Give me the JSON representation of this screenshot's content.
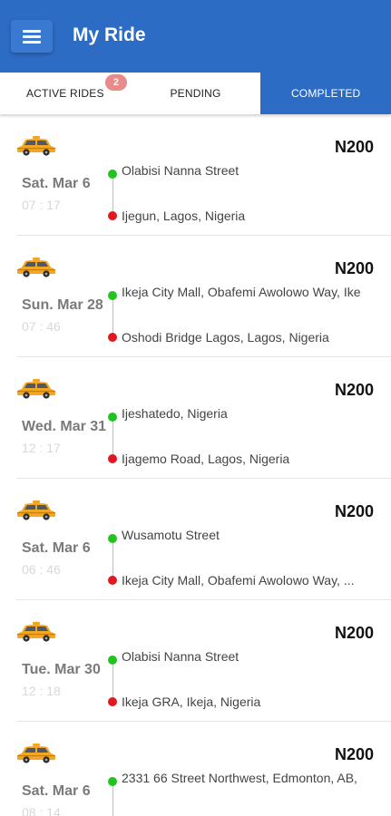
{
  "app": {
    "title": "My Ride"
  },
  "tabs": [
    {
      "label": "ACTIVE RIDES",
      "badge": "2",
      "active": false
    },
    {
      "label": "PENDING",
      "active": false
    },
    {
      "label": "COMPLETED",
      "active": true
    }
  ],
  "colors": {
    "primary": "#2d6cc4",
    "pickup_dot": "#1fc41f",
    "dropoff_dot": "#e3171e",
    "badge": "#e88a8a",
    "taxi": "#f2a623"
  },
  "icons": {
    "menu": "menu-icon",
    "ride": "taxi-icon",
    "pickup": "green-dot",
    "dropoff": "red-dot"
  },
  "rides": [
    {
      "price": "N200",
      "date": "Sat. Mar 6",
      "time": "07 : 17",
      "from": "Olabisi Nanna Street",
      "to": "Ijegun, Lagos, Nigeria"
    },
    {
      "price": "N200",
      "date": "Sun. Mar 28",
      "time": "07 : 46",
      "from": "Ikeja City Mall, Obafemi Awolowo Way, Ike",
      "to": "Oshodi Bridge Lagos, Lagos, Nigeria"
    },
    {
      "price": "N200",
      "date": "Wed. Mar 31",
      "time": "12 : 17",
      "from": "Ijeshatedo, Nigeria",
      "to": "Ijagemo Road, Lagos, Nigeria"
    },
    {
      "price": "N200",
      "date": "Sat. Mar 6",
      "time": "06 : 46",
      "from": "Wusamotu Street",
      "to": "Ikeja City Mall, Obafemi Awolowo Way, ..."
    },
    {
      "price": "N200",
      "date": "Tue. Mar 30",
      "time": "12 : 18",
      "from": "Olabisi Nanna Street",
      "to": "Ikeja GRA, Ikeja, Nigeria"
    },
    {
      "price": "N200",
      "date": "Sat. Mar 6",
      "time": "08 : 14",
      "from": "2331 66 Street Northwest, Edmonton, AB,",
      "to": ""
    }
  ]
}
